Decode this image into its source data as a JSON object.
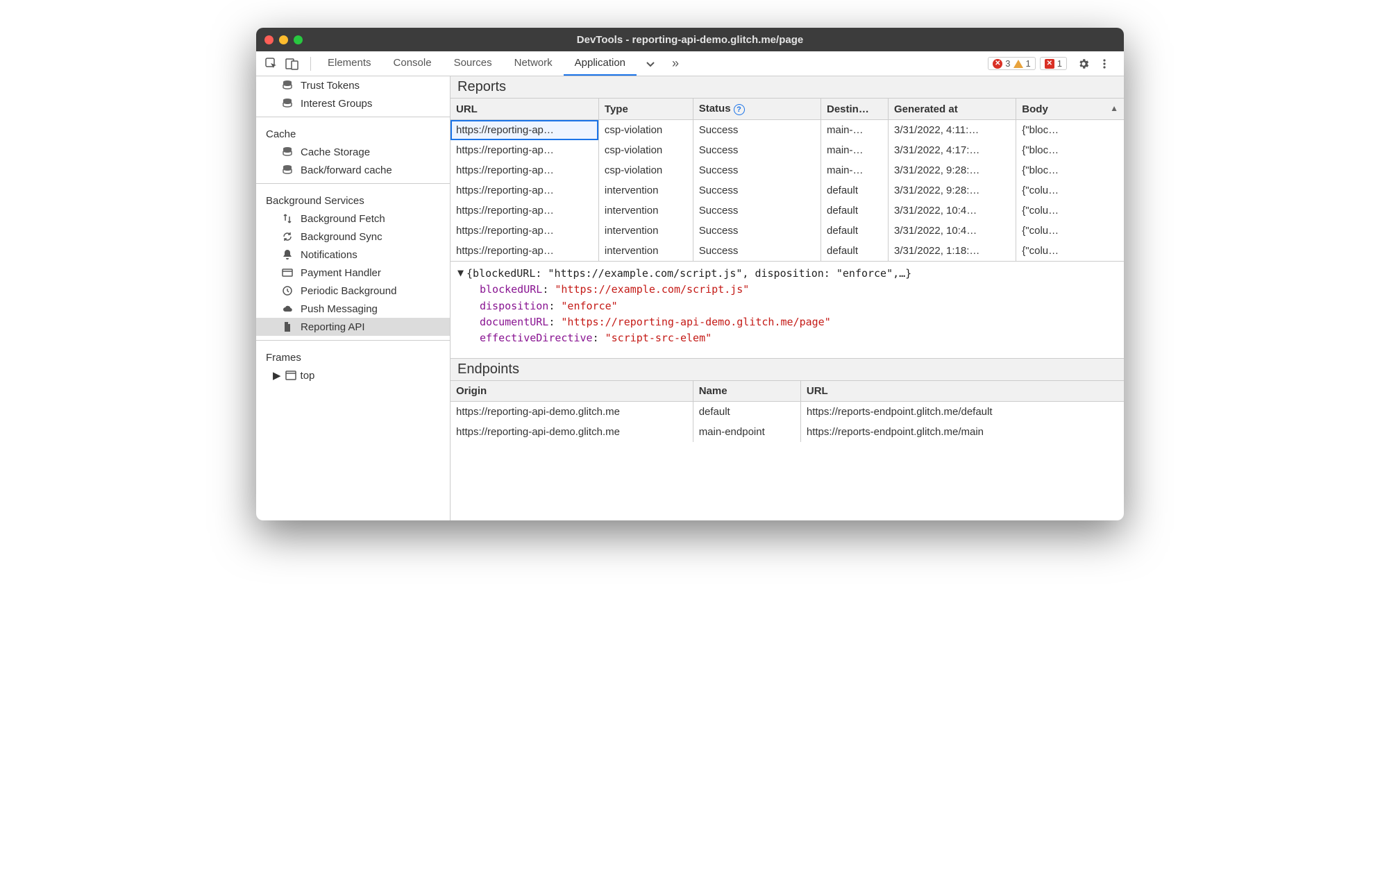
{
  "window": {
    "title": "DevTools - reporting-api-demo.glitch.me/page"
  },
  "toolbar": {
    "tabs": [
      "Elements",
      "Console",
      "Sources",
      "Network",
      "Application"
    ],
    "active_tab": "Application",
    "errors": 3,
    "warnings": 1,
    "issues": 1
  },
  "sidebar": {
    "pre_items": [
      "Trust Tokens",
      "Interest Groups"
    ],
    "groups": [
      {
        "title": "Cache",
        "items": [
          "Cache Storage",
          "Back/forward cache"
        ]
      },
      {
        "title": "Background Services",
        "items": [
          "Background Fetch",
          "Background Sync",
          "Notifications",
          "Payment Handler",
          "Periodic Background",
          "Push Messaging",
          "Reporting API"
        ],
        "selected": "Reporting API"
      },
      {
        "title": "Frames",
        "items": [
          "top"
        ]
      }
    ]
  },
  "reports": {
    "title": "Reports",
    "columns": [
      "URL",
      "Type",
      "Status",
      "Destin…",
      "Generated at",
      "Body"
    ],
    "rows": [
      {
        "url": "https://reporting-ap…",
        "type": "csp-violation",
        "status": "Success",
        "dest": "main-…",
        "time": "3/31/2022, 4:11:…",
        "body": "{\"bloc…",
        "selected": true
      },
      {
        "url": "https://reporting-ap…",
        "type": "csp-violation",
        "status": "Success",
        "dest": "main-…",
        "time": "3/31/2022, 4:17:…",
        "body": "{\"bloc…"
      },
      {
        "url": "https://reporting-ap…",
        "type": "csp-violation",
        "status": "Success",
        "dest": "main-…",
        "time": "3/31/2022, 9:28:…",
        "body": "{\"bloc…"
      },
      {
        "url": "https://reporting-ap…",
        "type": "intervention",
        "status": "Success",
        "dest": "default",
        "time": "3/31/2022, 9:28:…",
        "body": "{\"colu…"
      },
      {
        "url": "https://reporting-ap…",
        "type": "intervention",
        "status": "Success",
        "dest": "default",
        "time": "3/31/2022, 10:4…",
        "body": "{\"colu…"
      },
      {
        "url": "https://reporting-ap…",
        "type": "intervention",
        "status": "Success",
        "dest": "default",
        "time": "3/31/2022, 10:4…",
        "body": "{\"colu…"
      },
      {
        "url": "https://reporting-ap…",
        "type": "intervention",
        "status": "Success",
        "dest": "default",
        "time": "3/31/2022, 1:18:…",
        "body": "{\"colu…"
      }
    ]
  },
  "detail": {
    "summary": "{blockedURL: \"https://example.com/script.js\", disposition: \"enforce\",…}",
    "props": [
      {
        "k": "blockedURL",
        "v": "\"https://example.com/script.js\""
      },
      {
        "k": "disposition",
        "v": "\"enforce\""
      },
      {
        "k": "documentURL",
        "v": "\"https://reporting-api-demo.glitch.me/page\""
      },
      {
        "k": "effectiveDirective",
        "v": "\"script-src-elem\""
      }
    ]
  },
  "endpoints": {
    "title": "Endpoints",
    "columns": [
      "Origin",
      "Name",
      "URL"
    ],
    "rows": [
      {
        "origin": "https://reporting-api-demo.glitch.me",
        "name": "default",
        "url": "https://reports-endpoint.glitch.me/default"
      },
      {
        "origin": "https://reporting-api-demo.glitch.me",
        "name": "main-endpoint",
        "url": "https://reports-endpoint.glitch.me/main"
      }
    ]
  }
}
